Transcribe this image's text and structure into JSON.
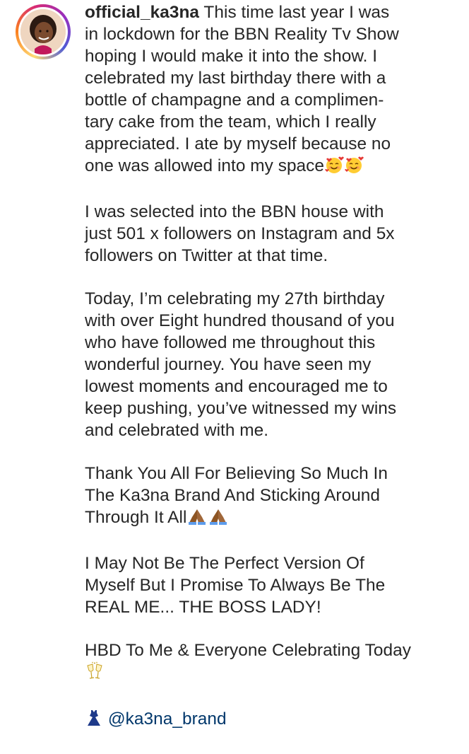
{
  "post": {
    "username": "official_ka3na",
    "avatar_icon": "profile-photo",
    "ring_colors": [
      "#feda75",
      "#fa7e1e",
      "#d62976",
      "#962fbf",
      "#4f5bd5"
    ],
    "p1": {
      "l1": "This time last year I was",
      "l2": "in lockdown for the BBN Reality Tv Show",
      "l3": "hoping I would make it into the show. I",
      "l4": "celebrated my last birthday there with a",
      "l5": "bottle of champagne and a complimen-",
      "l6": "tary cake from the team, which I really",
      "l7": "appreciated. I ate by myself because no",
      "l8": "one was allowed into my space",
      "emoji": "smiling-face-with-hearts-icon"
    },
    "p2": {
      "l1": "I was selected into the BBN house with",
      "l2": "just 501 x followers on Instagram and 5x",
      "l3": "followers on Twitter at that time."
    },
    "p3": {
      "l1": "Today,  I’m celebrating my 27th birthday",
      "l2": "with over Eight hundred thousand of you",
      "l3": "who have followed me throughout this",
      "l4": "wonderful journey. You have seen my",
      "l5": "lowest moments and encouraged me to",
      "l6": "keep pushing, you’ve witnessed my wins",
      "l7": "and celebrated with me."
    },
    "p4": {
      "l1": "Thank You All For Believing So Much In",
      "l2": "The Ka3na Brand And Sticking Around",
      "l3": "Through It All",
      "emoji": "folded-hands-icon"
    },
    "p5": {
      "l1": "I May Not Be The Perfect Version Of",
      "l2": "Myself But I Promise To Always Be The",
      "l3": "REAL ME... THE BOSS LADY!"
    },
    "p6": {
      "l1": "HBD To Me & Everyone Celebrating Today",
      "emoji": "clinking-glasses-icon"
    },
    "p7": {
      "mention": "@ka3na_brand",
      "emoji": "dress-icon"
    }
  }
}
